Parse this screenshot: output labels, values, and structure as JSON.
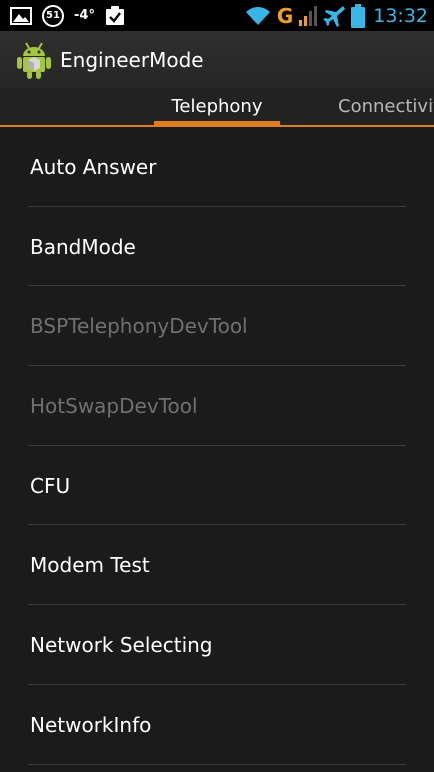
{
  "status_bar": {
    "badge_number": "51",
    "temperature": "-4°",
    "network_type": "G",
    "time": "13:32",
    "icons": [
      "gallery-icon",
      "badge-icon",
      "clipboard-check-icon",
      "wifi-icon",
      "signal-icon",
      "airplane-icon",
      "battery-icon"
    ]
  },
  "action_bar": {
    "title": "EngineerMode",
    "icon": "android-app-icon"
  },
  "tabs": [
    {
      "label": "Telephony",
      "selected": true
    },
    {
      "label": "Connectivity",
      "selected": false
    }
  ],
  "list": {
    "items": [
      {
        "label": "Auto Answer",
        "enabled": true
      },
      {
        "label": "BandMode",
        "enabled": true
      },
      {
        "label": "BSPTelephonyDevTool",
        "enabled": false
      },
      {
        "label": "HotSwapDevTool",
        "enabled": false
      },
      {
        "label": "CFU",
        "enabled": true
      },
      {
        "label": "Modem Test",
        "enabled": true
      },
      {
        "label": "Network Selecting",
        "enabled": true
      },
      {
        "label": "NetworkInfo",
        "enabled": true
      }
    ]
  },
  "colors": {
    "accent": "#e07c22",
    "clock": "#38b7e6",
    "network_type": "#f0a020",
    "background": "#1b1b1b",
    "disabled_text": "#707070"
  }
}
